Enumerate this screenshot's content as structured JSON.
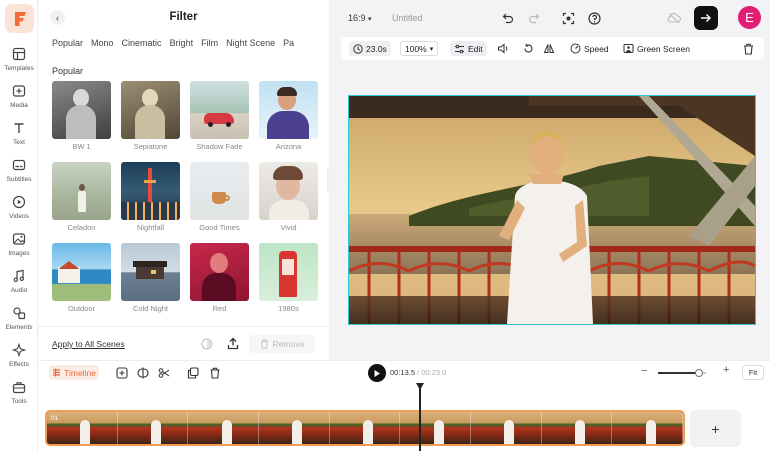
{
  "rail": {
    "logo_letter": "F",
    "items": [
      {
        "label": "Templates",
        "icon": "templates-icon"
      },
      {
        "label": "Media",
        "icon": "media-icon"
      },
      {
        "label": "Text",
        "icon": "text-icon"
      },
      {
        "label": "Subtitles",
        "icon": "subtitles-icon"
      },
      {
        "label": "Videos",
        "icon": "videos-icon"
      },
      {
        "label": "Images",
        "icon": "images-icon"
      },
      {
        "label": "Audio",
        "icon": "audio-icon"
      },
      {
        "label": "Elements",
        "icon": "elements-icon"
      },
      {
        "label": "Effects",
        "icon": "effects-icon"
      },
      {
        "label": "Tools",
        "icon": "tools-icon"
      }
    ]
  },
  "panel": {
    "title": "Filter",
    "tabs": [
      "Popular",
      "Mono",
      "Cinematic",
      "Bright",
      "Film",
      "Night Scene",
      "Pa"
    ],
    "section_title": "Popular",
    "filters": [
      "BW 1",
      "Sepiatone",
      "Shadow Fade",
      "Arizona",
      "Celadon",
      "Nightfall",
      "Good Times",
      "Vivid",
      "Outdoor",
      "Cold Night",
      "Red",
      "1980s"
    ],
    "apply_label": "Apply to All Scenes",
    "remove_label": "Remove"
  },
  "topbar": {
    "ratio": "16:9",
    "doc_title": "Untitled",
    "avatar_letter": "E"
  },
  "toolbar": {
    "duration": "23.0s",
    "zoom": "100%",
    "edit_label": "Edit",
    "speed_label": "Speed",
    "green_screen_label": "Green Screen"
  },
  "timeline": {
    "label": "Timeline",
    "current_time": "00:13.5",
    "separator": " / ",
    "total_time": "00:23.0",
    "fit_label": "Fit",
    "clip_number": "01",
    "zoom_level": 0.86,
    "add_label": "+"
  },
  "colors": {
    "brand": "#f26b3a",
    "accent_cyan": "#2fc6d6",
    "clip_border": "#f29c55",
    "avatar": "#e11d74"
  }
}
